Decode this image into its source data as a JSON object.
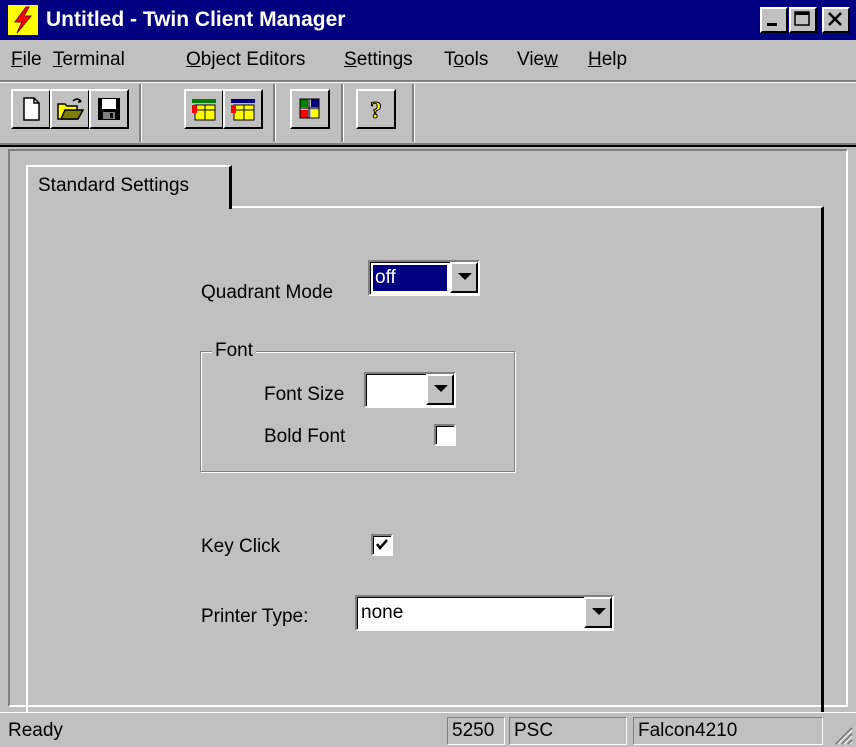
{
  "window": {
    "title": "Untitled - Twin Client Manager",
    "icon": "lightning-icon"
  },
  "menu": {
    "items": [
      {
        "label": "File",
        "mnemonic": "F"
      },
      {
        "label": "Terminal",
        "mnemonic": "T"
      },
      {
        "label": "Object Editors",
        "mnemonic": "O"
      },
      {
        "label": "Settings",
        "mnemonic": "S"
      },
      {
        "label": "Tools",
        "mnemonic": "o"
      },
      {
        "label": "View",
        "mnemonic": "w"
      },
      {
        "label": "Help",
        "mnemonic": "H"
      }
    ]
  },
  "toolbar": {
    "buttons": [
      "new-file-icon",
      "open-folder-icon",
      "save-disk-icon",
      "object-editor-icon",
      "object-editor-alt-icon",
      "settings-grid-icon",
      "help-question-icon"
    ]
  },
  "tabs": [
    {
      "label": "Standard Settings",
      "active": true
    }
  ],
  "form": {
    "quadrant_mode": {
      "label": "Quadrant Mode",
      "value": "off"
    },
    "font_group": {
      "title": "Font",
      "font_size": {
        "label": "Font Size",
        "value": ""
      },
      "bold_font": {
        "label": "Bold Font",
        "checked": false
      }
    },
    "key_click": {
      "label": "Key Click",
      "checked": true
    },
    "printer_type": {
      "label": "Printer Type:",
      "value": "none"
    }
  },
  "status": {
    "message": "Ready",
    "pane1": "5250",
    "pane2": "PSC",
    "pane3": "Falcon4210"
  },
  "colors": {
    "titlebar": "#000080",
    "face": "#c0c0c0",
    "selection": "#000080"
  }
}
